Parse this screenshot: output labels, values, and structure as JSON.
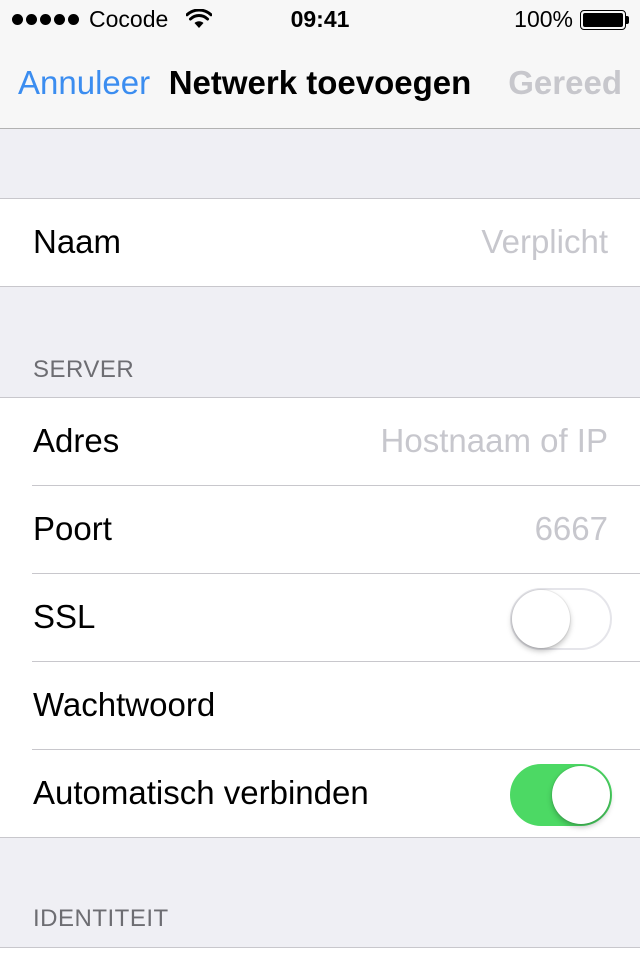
{
  "status_bar": {
    "carrier": "Cocode",
    "time": "09:41",
    "battery": "100%",
    "signal_bars": 5,
    "wifi_icon": "wifi-icon",
    "battery_icon": "battery-full-icon"
  },
  "nav": {
    "cancel_label": "Annuleer",
    "title": "Netwerk toevoegen",
    "done_label": "Gereed",
    "accent_color": "#3b8df0",
    "disabled_color": "#c7c7cc"
  },
  "name_group": {
    "label": "Naam",
    "placeholder": "Verplicht"
  },
  "server": {
    "header": "SERVER",
    "address_label": "Adres",
    "address_placeholder": "Hostnaam of IP",
    "port_label": "Poort",
    "port_placeholder": "6667",
    "ssl_label": "SSL",
    "ssl_enabled": false,
    "password_label": "Wachtwoord",
    "autoconnect_label": "Automatisch verbinden",
    "autoconnect_enabled": true,
    "toggle_on_color": "#4cd964"
  },
  "identity": {
    "header": "IDENTITEIT"
  }
}
